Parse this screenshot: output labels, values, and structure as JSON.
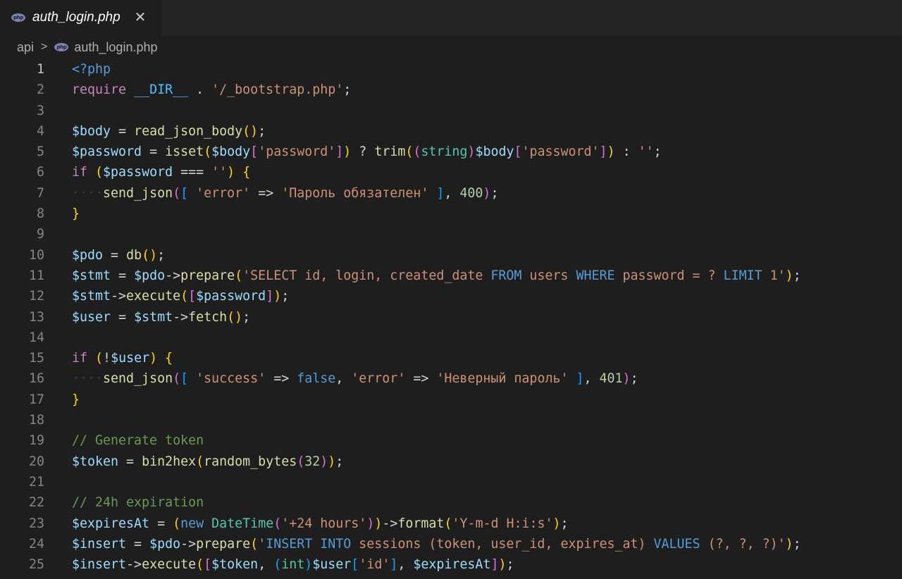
{
  "tab": {
    "title": "auth_login.php",
    "close": "✕",
    "icon": "php-file-icon"
  },
  "breadcrumb": {
    "folder": "api",
    "file": "auth_login.php"
  },
  "lines": [
    {
      "n": "1",
      "tokens": [
        [
          "tag",
          "<?php"
        ]
      ]
    },
    {
      "n": "2",
      "tokens": [
        [
          "kw",
          "require"
        ],
        [
          "o",
          " "
        ],
        [
          "const",
          "__DIR__"
        ],
        [
          "o",
          " . "
        ],
        [
          "s",
          "'/_bootstrap.php'"
        ],
        [
          "o",
          ";"
        ]
      ]
    },
    {
      "n": "3",
      "tokens": []
    },
    {
      "n": "4",
      "tokens": [
        [
          "v",
          "$body"
        ],
        [
          "o",
          " = "
        ],
        [
          "f",
          "read_json_body"
        ],
        [
          "b1",
          "()"
        ],
        [
          "o",
          ";"
        ]
      ]
    },
    {
      "n": "5",
      "tokens": [
        [
          "v",
          "$password"
        ],
        [
          "o",
          " = "
        ],
        [
          "f",
          "isset"
        ],
        [
          "b1",
          "("
        ],
        [
          "v",
          "$body"
        ],
        [
          "b2",
          "["
        ],
        [
          "s",
          "'password'"
        ],
        [
          "b2",
          "]"
        ],
        [
          "b1",
          ")"
        ],
        [
          "o",
          " ? "
        ],
        [
          "f",
          "trim"
        ],
        [
          "b1",
          "("
        ],
        [
          "b2",
          "("
        ],
        [
          "t",
          "string"
        ],
        [
          "b2",
          ")"
        ],
        [
          "v",
          "$body"
        ],
        [
          "b2",
          "["
        ],
        [
          "s",
          "'password'"
        ],
        [
          "b2",
          "]"
        ],
        [
          "b1",
          ")"
        ],
        [
          "o",
          " : "
        ],
        [
          "s",
          "''"
        ],
        [
          "o",
          ";"
        ]
      ]
    },
    {
      "n": "6",
      "tokens": [
        [
          "kw",
          "if"
        ],
        [
          "o",
          " "
        ],
        [
          "b1",
          "("
        ],
        [
          "v",
          "$password"
        ],
        [
          "o",
          " === "
        ],
        [
          "s",
          "''"
        ],
        [
          "b1",
          ")"
        ],
        [
          "o",
          " "
        ],
        [
          "b1",
          "{"
        ]
      ]
    },
    {
      "n": "7",
      "tokens": [
        [
          "ws",
          "····"
        ],
        [
          "f",
          "send_json"
        ],
        [
          "b2",
          "("
        ],
        [
          "b3",
          "["
        ],
        [
          "o",
          " "
        ],
        [
          "s",
          "'error'"
        ],
        [
          "o",
          " => "
        ],
        [
          "s",
          "'Пароль обязателен'"
        ],
        [
          "o",
          " "
        ],
        [
          "b3",
          "]"
        ],
        [
          "o",
          ", "
        ],
        [
          "n",
          "400"
        ],
        [
          "b2",
          ")"
        ],
        [
          "o",
          ";"
        ]
      ]
    },
    {
      "n": "8",
      "tokens": [
        [
          "b1",
          "}"
        ]
      ]
    },
    {
      "n": "9",
      "tokens": []
    },
    {
      "n": "10",
      "tokens": [
        [
          "v",
          "$pdo"
        ],
        [
          "o",
          " = "
        ],
        [
          "f",
          "db"
        ],
        [
          "b1",
          "()"
        ],
        [
          "o",
          ";"
        ]
      ]
    },
    {
      "n": "11",
      "tokens": [
        [
          "v",
          "$stmt"
        ],
        [
          "o",
          " = "
        ],
        [
          "v",
          "$pdo"
        ],
        [
          "o",
          "->"
        ],
        [
          "f",
          "prepare"
        ],
        [
          "b1",
          "("
        ],
        [
          "s",
          "'SELECT id, login, created_date "
        ],
        [
          "k",
          "FROM"
        ],
        [
          "s",
          " users "
        ],
        [
          "k",
          "WHERE"
        ],
        [
          "s",
          " password = ? "
        ],
        [
          "k",
          "LIMIT"
        ],
        [
          "s",
          " 1'"
        ],
        [
          "b1",
          ")"
        ],
        [
          "o",
          ";"
        ]
      ]
    },
    {
      "n": "12",
      "tokens": [
        [
          "v",
          "$stmt"
        ],
        [
          "o",
          "->"
        ],
        [
          "f",
          "execute"
        ],
        [
          "b1",
          "("
        ],
        [
          "b2",
          "["
        ],
        [
          "v",
          "$password"
        ],
        [
          "b2",
          "]"
        ],
        [
          "b1",
          ")"
        ],
        [
          "o",
          ";"
        ]
      ]
    },
    {
      "n": "13",
      "tokens": [
        [
          "v",
          "$user"
        ],
        [
          "o",
          " = "
        ],
        [
          "v",
          "$stmt"
        ],
        [
          "o",
          "->"
        ],
        [
          "f",
          "fetch"
        ],
        [
          "b1",
          "()"
        ],
        [
          "o",
          ";"
        ]
      ]
    },
    {
      "n": "14",
      "tokens": []
    },
    {
      "n": "15",
      "tokens": [
        [
          "kw",
          "if"
        ],
        [
          "o",
          " "
        ],
        [
          "b1",
          "("
        ],
        [
          "o",
          "!"
        ],
        [
          "v",
          "$user"
        ],
        [
          "b1",
          ")"
        ],
        [
          "o",
          " "
        ],
        [
          "b1",
          "{"
        ]
      ]
    },
    {
      "n": "16",
      "tokens": [
        [
          "ws",
          "····"
        ],
        [
          "f",
          "send_json"
        ],
        [
          "b2",
          "("
        ],
        [
          "b3",
          "["
        ],
        [
          "o",
          " "
        ],
        [
          "s",
          "'success'"
        ],
        [
          "o",
          " => "
        ],
        [
          "k",
          "false"
        ],
        [
          "o",
          ", "
        ],
        [
          "s",
          "'error'"
        ],
        [
          "o",
          " => "
        ],
        [
          "s",
          "'Неверный пароль'"
        ],
        [
          "o",
          " "
        ],
        [
          "b3",
          "]"
        ],
        [
          "o",
          ", "
        ],
        [
          "n",
          "401"
        ],
        [
          "b2",
          ")"
        ],
        [
          "o",
          ";"
        ]
      ]
    },
    {
      "n": "17",
      "tokens": [
        [
          "b1",
          "}"
        ]
      ]
    },
    {
      "n": "18",
      "tokens": []
    },
    {
      "n": "19",
      "tokens": [
        [
          "c",
          "// Generate token"
        ]
      ]
    },
    {
      "n": "20",
      "tokens": [
        [
          "v",
          "$token"
        ],
        [
          "o",
          " = "
        ],
        [
          "f",
          "bin2hex"
        ],
        [
          "b1",
          "("
        ],
        [
          "f",
          "random_bytes"
        ],
        [
          "b2",
          "("
        ],
        [
          "n",
          "32"
        ],
        [
          "b2",
          ")"
        ],
        [
          "b1",
          ")"
        ],
        [
          "o",
          ";"
        ]
      ]
    },
    {
      "n": "21",
      "tokens": []
    },
    {
      "n": "22",
      "tokens": [
        [
          "c",
          "// 24h expiration"
        ]
      ]
    },
    {
      "n": "23",
      "tokens": [
        [
          "v",
          "$expiresAt"
        ],
        [
          "o",
          " = "
        ],
        [
          "b1",
          "("
        ],
        [
          "k",
          "new"
        ],
        [
          "o",
          " "
        ],
        [
          "t",
          "DateTime"
        ],
        [
          "b2",
          "("
        ],
        [
          "s",
          "'+24 hours'"
        ],
        [
          "b2",
          ")"
        ],
        [
          "b1",
          ")"
        ],
        [
          "o",
          "->"
        ],
        [
          "f",
          "format"
        ],
        [
          "b1",
          "("
        ],
        [
          "s",
          "'Y-m-d H:i:s'"
        ],
        [
          "b1",
          ")"
        ],
        [
          "o",
          ";"
        ]
      ]
    },
    {
      "n": "24",
      "tokens": [
        [
          "v",
          "$insert"
        ],
        [
          "o",
          " = "
        ],
        [
          "v",
          "$pdo"
        ],
        [
          "o",
          "->"
        ],
        [
          "f",
          "prepare"
        ],
        [
          "b1",
          "("
        ],
        [
          "s",
          "'"
        ],
        [
          "k",
          "INSERT INTO"
        ],
        [
          "s",
          " sessions (token, user_id, expires_at) "
        ],
        [
          "k",
          "VALUES"
        ],
        [
          "s",
          " (?, ?, ?)'"
        ],
        [
          "b1",
          ")"
        ],
        [
          "o",
          ";"
        ]
      ]
    },
    {
      "n": "25",
      "tokens": [
        [
          "v",
          "$insert"
        ],
        [
          "o",
          "->"
        ],
        [
          "f",
          "execute"
        ],
        [
          "b1",
          "("
        ],
        [
          "b2",
          "["
        ],
        [
          "v",
          "$token"
        ],
        [
          "o",
          ", "
        ],
        [
          "b3",
          "("
        ],
        [
          "t",
          "int"
        ],
        [
          "b3",
          ")"
        ],
        [
          "v",
          "$user"
        ],
        [
          "b3",
          "["
        ],
        [
          "s",
          "'id'"
        ],
        [
          "b3",
          "]"
        ],
        [
          "o",
          ", "
        ],
        [
          "v",
          "$expiresAt"
        ],
        [
          "b2",
          "]"
        ],
        [
          "b1",
          ")"
        ],
        [
          "o",
          ";"
        ]
      ]
    }
  ]
}
